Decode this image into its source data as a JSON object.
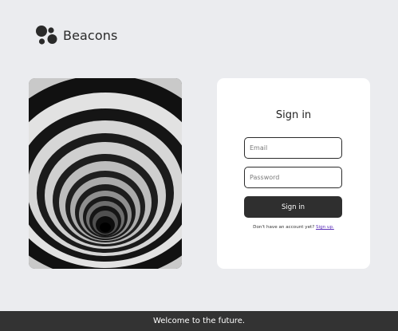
{
  "brand": {
    "name": "Beacons",
    "logo_icon": "beacons-dots-logo-icon"
  },
  "hero": {
    "image": "concentric-spiral-tunnel-photo"
  },
  "signin": {
    "title": "Sign in",
    "email_placeholder": "Email",
    "password_placeholder": "Password",
    "button_label": "Sign in",
    "prompt_text": "Don't have an account yet?",
    "signup_link": "Sign up."
  },
  "footer": {
    "text": "Welcome to the future."
  },
  "colors": {
    "background": "#ebecef",
    "card": "#ffffff",
    "button": "#2f2f2f",
    "link": "#5b2fb8",
    "footer": "#333333"
  }
}
